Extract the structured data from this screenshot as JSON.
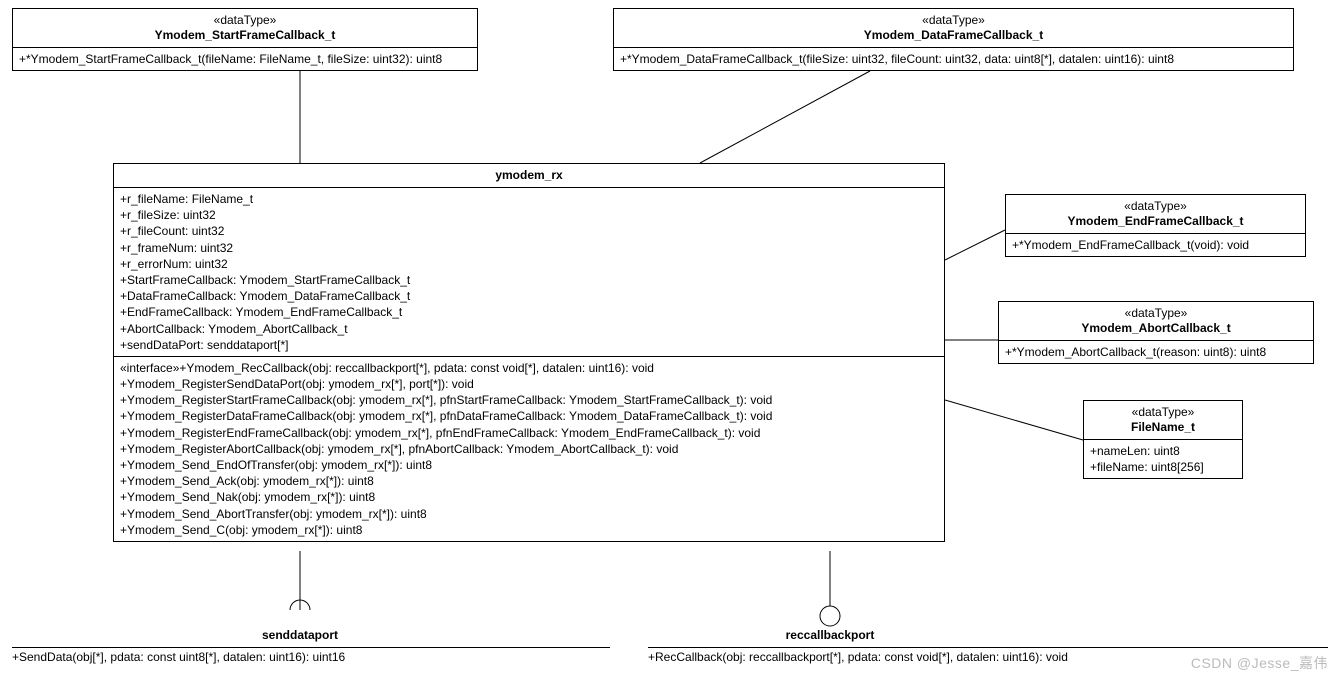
{
  "stereotype": "«dataType»",
  "interfaceStereo": "«interface»",
  "startCB": {
    "name": "Ymodem_StartFrameCallback_t",
    "op": "+*Ymodem_StartFrameCallback_t(fileName: FileName_t, fileSize: uint32): uint8"
  },
  "dataCB": {
    "name": "Ymodem_DataFrameCallback_t",
    "op": "+*Ymodem_DataFrameCallback_t(fileSize: uint32, fileCount: uint32, data: uint8[*], datalen: uint16): uint8"
  },
  "endCB": {
    "name": "Ymodem_EndFrameCallback_t",
    "op": "+*Ymodem_EndFrameCallback_t(void): void"
  },
  "abortCB": {
    "name": "Ymodem_AbortCallback_t",
    "op": "+*Ymodem_AbortCallback_t(reason: uint8): uint8"
  },
  "fileName": {
    "name": "FileName_t",
    "a1": "+nameLen: uint8",
    "a2": "+fileName: uint8[256]"
  },
  "rx": {
    "name": "ymodem_rx",
    "attrs": [
      "+r_fileName: FileName_t",
      "+r_fileSize: uint32",
      "+r_fileCount: uint32",
      "+r_frameNum: uint32",
      "+r_errorNum: uint32",
      "+StartFrameCallback: Ymodem_StartFrameCallback_t",
      "+DataFrameCallback: Ymodem_DataFrameCallback_t",
      "+EndFrameCallback: Ymodem_EndFrameCallback_t",
      "+AbortCallback: Ymodem_AbortCallback_t",
      "+sendDataPort: senddataport[*]"
    ],
    "ops": [
      "«interface»+Ymodem_RecCallback(obj: reccallbackport[*], pdata: const void[*], datalen: uint16): void",
      "+Ymodem_RegisterSendDataPort(obj: ymodem_rx[*], port[*]): void",
      "+Ymodem_RegisterStartFrameCallback(obj: ymodem_rx[*], pfnStartFrameCallback: Ymodem_StartFrameCallback_t): void",
      "+Ymodem_RegisterDataFrameCallback(obj: ymodem_rx[*], pfnDataFrameCallback: Ymodem_DataFrameCallback_t): void",
      "+Ymodem_RegisterEndFrameCallback(obj: ymodem_rx[*], pfnEndFrameCallback: Ymodem_EndFrameCallback_t): void",
      "+Ymodem_RegisterAbortCallback(obj: ymodem_rx[*], pfnAbortCallback: Ymodem_AbortCallback_t): void",
      "+Ymodem_Send_EndOfTransfer(obj: ymodem_rx[*]): uint8",
      "+Ymodem_Send_Ack(obj: ymodem_rx[*]): uint8",
      "+Ymodem_Send_Nak(obj: ymodem_rx[*]): uint8",
      "+Ymodem_Send_AbortTransfer(obj: ymodem_rx[*]): uint8",
      "+Ymodem_Send_C(obj: ymodem_rx[*]): uint8"
    ]
  },
  "sendPort": {
    "name": "senddataport",
    "op": "+SendData(obj[*], pdata: const uint8[*], datalen: uint16): uint16"
  },
  "recPort": {
    "name": "reccallbackport",
    "op": "+RecCallback(obj: reccallbackport[*], pdata: const void[*], datalen: uint16): void"
  },
  "watermark": "CSDN @Jesse_嘉伟"
}
